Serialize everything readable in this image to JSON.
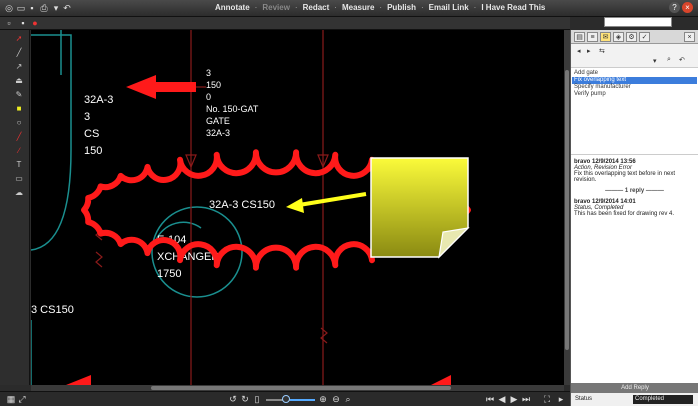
{
  "menu": {
    "items": [
      "Annotate",
      "Review",
      "Redact",
      "Measure",
      "Publish",
      "Email Link",
      "I Have Read This"
    ],
    "dimmed_index": 1
  },
  "drawing": {
    "block_lines": [
      "3",
      "150",
      "0",
      "No. 150-GAT",
      "GATE",
      "32A-3"
    ],
    "left_label_lines": [
      "32A-3",
      "3",
      "CS",
      "150"
    ],
    "pipe_label": "32A-3 CS150",
    "exchanger_lines": [
      "E-104",
      "XCHANGER",
      "1750"
    ],
    "bottom_left_label": "3 CS150"
  },
  "panel": {
    "comments": [
      "Add gate",
      "Fix overlapping text",
      "Specify manufacturer",
      "Verify pump"
    ],
    "selected_index": 1,
    "thread": {
      "author1": "bravo 12/9/2014 13:56",
      "action1": "Action, Revision Error",
      "text1": "Fix this overlapping text before in next revision.",
      "reply_count": "1 reply",
      "author2": "bravo 12/9/2014 14:01",
      "action2": "Status, Completed",
      "text2": "This has been fixed for drawing rev 4."
    },
    "add_reply_label": "Add Reply",
    "status_label": "Status",
    "status_value": "Completed"
  },
  "colors": {
    "markup_red": "#ff1a1a",
    "drawing_teal": "#1a8f8f",
    "drawing_white": "#ffffff",
    "arrow_yellow": "#ffff1a",
    "selection_blue": "#3c7ddc"
  }
}
